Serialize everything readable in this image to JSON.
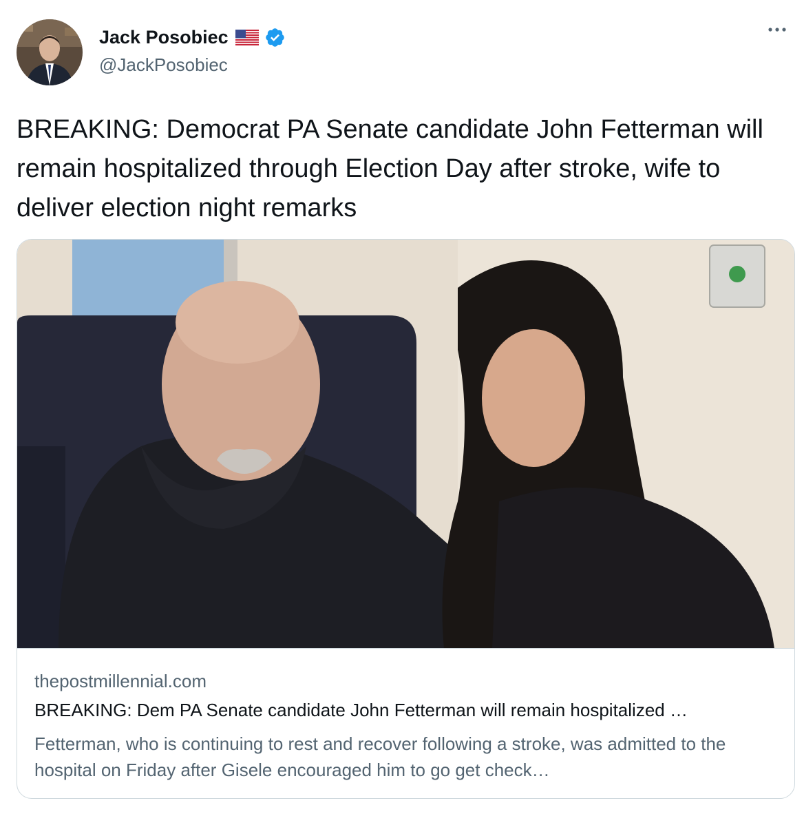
{
  "author": {
    "name": "Jack Posobiec",
    "handle": "@JackPosobiec",
    "flag_icon": "us-flag-icon",
    "verified_icon": "verified-badge-icon"
  },
  "tweet": {
    "text": "BREAKING: Democrat PA Senate candidate John Fetterman will remain hospitalized through Election Day after stroke, wife to deliver election night remarks"
  },
  "card": {
    "domain": "thepostmillennial.com",
    "title": "BREAKING: Dem PA Senate candidate John Fetterman will remain hospitalized …",
    "description": "Fetterman, who is continuing to rest and recover following a stroke, was admitted to the hospital on Friday after Gisele encouraged him to go get check…"
  },
  "colors": {
    "verified": "#1d9bf0",
    "secondary_text": "#536471",
    "border": "#cfd9de"
  }
}
